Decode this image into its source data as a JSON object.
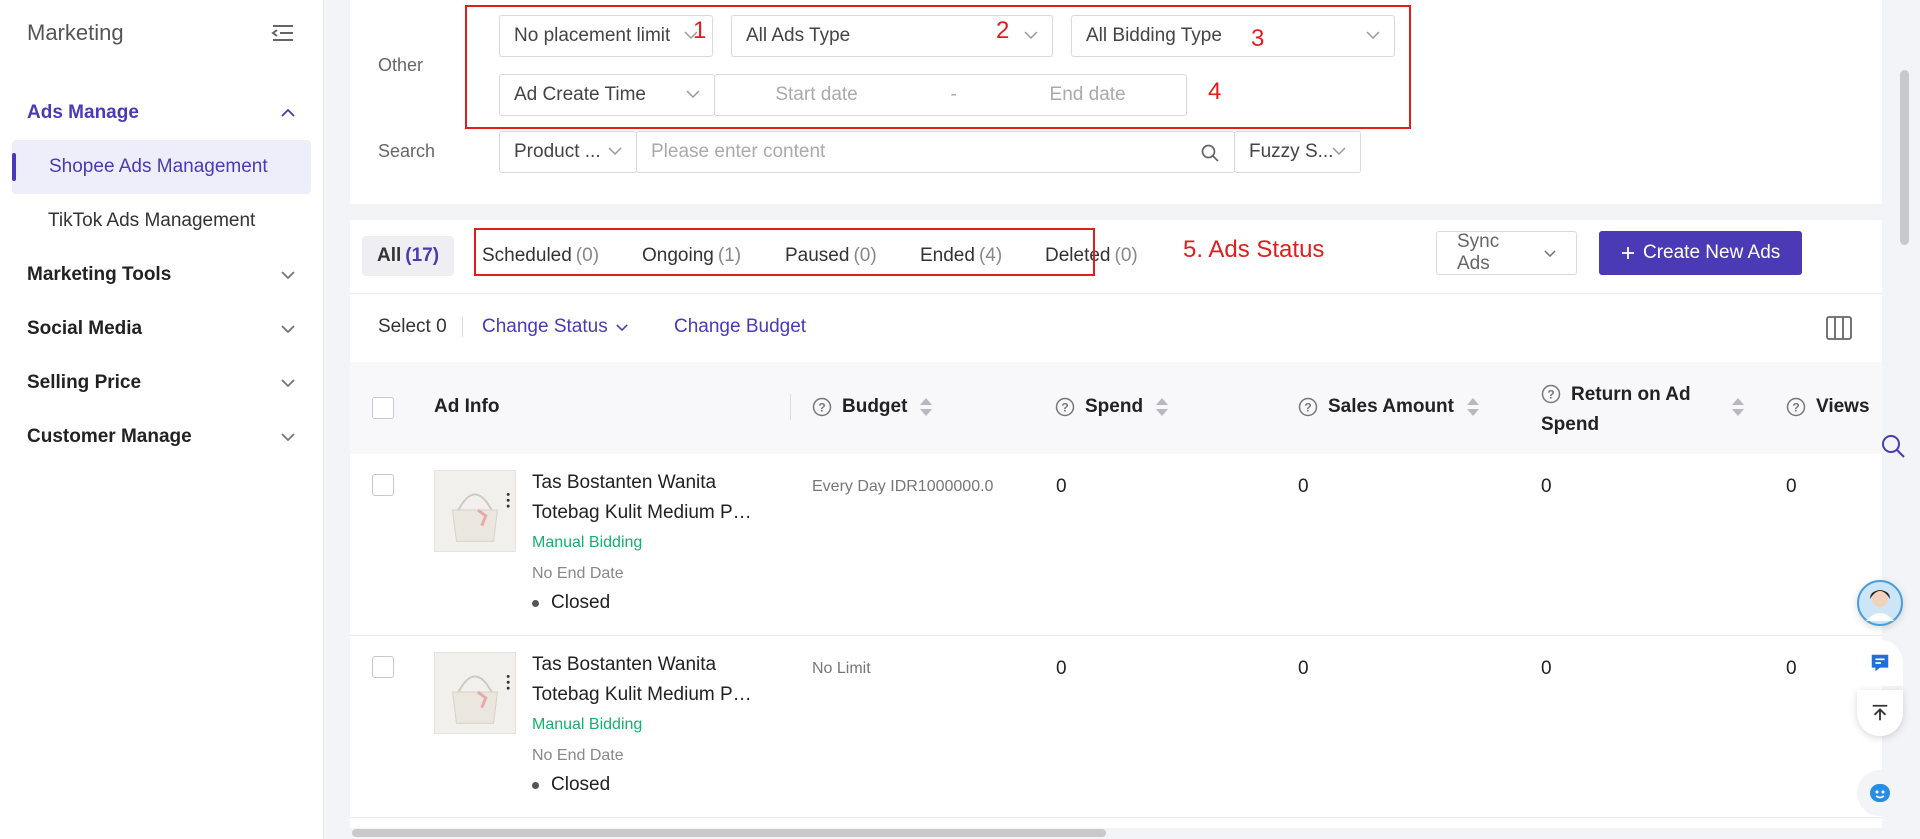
{
  "sidebar": {
    "title": "Marketing",
    "groups": [
      {
        "label": "Ads Manage"
      },
      {
        "label": "Marketing Tools"
      },
      {
        "label": "Social Media"
      },
      {
        "label": "Selling Price"
      },
      {
        "label": "Customer Manage"
      }
    ],
    "sub_items": [
      {
        "label": "Shopee Ads Management"
      },
      {
        "label": "TikTok Ads Management"
      }
    ]
  },
  "filters": {
    "other_label": "Other",
    "search_label": "Search",
    "placement": "No placement limit",
    "ads_type": "All Ads Type",
    "bidding_type": "All Bidding Type",
    "create_time": "Ad Create Time",
    "start_placeholder": "Start date",
    "date_separator": "-",
    "end_placeholder": "End date",
    "search_field": "Product ...",
    "search_placeholder": "Please enter content",
    "search_mode": "Fuzzy S..."
  },
  "annotations": {
    "n1": "1",
    "n2": "2",
    "n3": "3",
    "n4": "4",
    "n5": "5. Ads Status"
  },
  "tabs": [
    {
      "label": "All",
      "count": "(17)"
    },
    {
      "label": "Scheduled",
      "count": "(0)"
    },
    {
      "label": "Ongoing",
      "count": "(1)"
    },
    {
      "label": "Paused",
      "count": "(0)"
    },
    {
      "label": "Ended",
      "count": "(4)"
    },
    {
      "label": "Deleted",
      "count": "(0)"
    }
  ],
  "toolbar": {
    "select_label": "Select 0",
    "change_status": "Change Status",
    "change_budget": "Change Budget",
    "sync_ads": "Sync Ads",
    "create_new": "Create New Ads"
  },
  "table": {
    "headers": {
      "ad_info": "Ad Info",
      "budget": "Budget",
      "spend": "Spend",
      "sales_amount": "Sales Amount",
      "roas_line1": "Return on Ad",
      "roas_line2": "Spend",
      "views": "Views"
    },
    "rows": [
      {
        "name_line1": "Tas Bostanten Wanita",
        "name_line2": "Totebag Kulit Medium Pol...",
        "bidding": "Manual Bidding",
        "end_date": "No End Date",
        "status": "Closed",
        "budget": "Every Day IDR1000000.0",
        "spend": "0",
        "sales": "0",
        "roas": "0",
        "views": "0"
      },
      {
        "name_line1": "Tas Bostanten Wanita",
        "name_line2": "Totebag Kulit Medium Pol...",
        "bidding": "Manual Bidding",
        "end_date": "No End Date",
        "status": "Closed",
        "budget": "No Limit",
        "spend": "0",
        "sales": "0",
        "roas": "0",
        "views": "0"
      }
    ]
  },
  "colors": {
    "accent": "#4a3ab5",
    "annotation": "#e01e1e",
    "bidding": "#15b06d"
  },
  "icons": [
    "menu-collapse-icon",
    "chevron-up-icon",
    "chevron-down-icon",
    "search-icon",
    "question-icon",
    "sort-icon",
    "plus-icon",
    "columns-icon",
    "avatar",
    "chat-icon",
    "back-to-top-icon",
    "support-icon"
  ]
}
